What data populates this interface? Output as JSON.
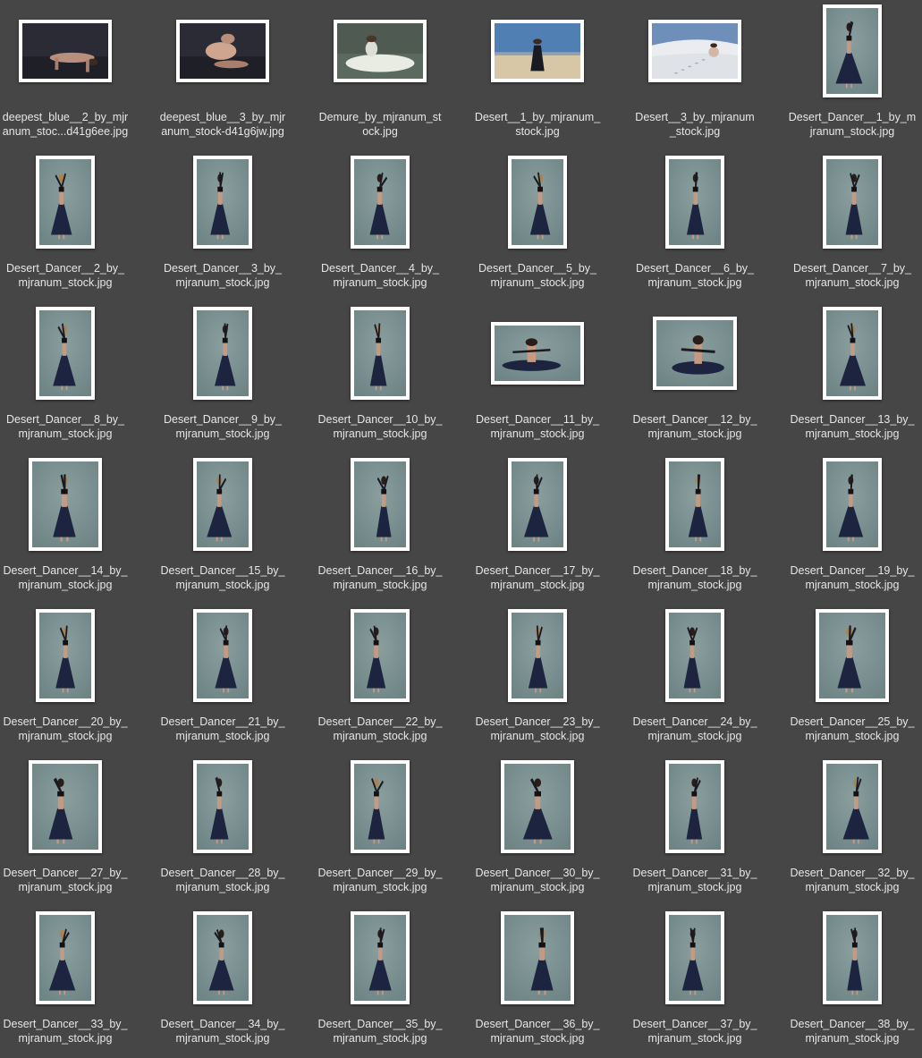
{
  "files": [
    {
      "name": "deepest_blue__2_by_mjranum_stock-d41g6ee.jpg",
      "label_lines": [
        "deepest_blue__2_by_mjr",
        "anum_stoc...d41g6ee.jpg"
      ],
      "kind": "dark-floor",
      "orientation": "landscape"
    },
    {
      "name": "deepest_blue__3_by_mjranum_stock-d41g6jw.jpg",
      "label_lines": [
        "deepest_blue__3_by_mjr",
        "anum_stock-d41g6jw.jpg"
      ],
      "kind": "dark-kneel",
      "orientation": "landscape"
    },
    {
      "name": "Demure_by_mjranum_stock.jpg",
      "label_lines": [
        "Demure_by_mjranum_st",
        "ock.jpg"
      ],
      "kind": "white-dress",
      "orientation": "landscape"
    },
    {
      "name": "Desert__1_by_mjranum_stock.jpg",
      "label_lines": [
        "Desert__1_by_mjranum_",
        "stock.jpg"
      ],
      "kind": "desert-standing",
      "orientation": "landscape"
    },
    {
      "name": "Desert__3_by_mjranum_stock.jpg",
      "label_lines": [
        "Desert__3_by_mjranum",
        "_stock.jpg"
      ],
      "kind": "desert-dune",
      "orientation": "landscape"
    },
    {
      "name": "Desert_Dancer__1_by_mjranum_stock.jpg",
      "label_lines": [
        "Desert_Dancer__1_by_m",
        "jranum_stock.jpg"
      ],
      "kind": "dancer",
      "orientation": "portrait"
    },
    {
      "name": "Desert_Dancer__2_by_mjranum_stock.jpg",
      "label_lines": [
        "Desert_Dancer__2_by_",
        "mjranum_stock.jpg"
      ],
      "kind": "dancer",
      "orientation": "portrait"
    },
    {
      "name": "Desert_Dancer__3_by_mjranum_stock.jpg",
      "label_lines": [
        "Desert_Dancer__3_by_",
        "mjranum_stock.jpg"
      ],
      "kind": "dancer",
      "orientation": "portrait"
    },
    {
      "name": "Desert_Dancer__4_by_mjranum_stock.jpg",
      "label_lines": [
        "Desert_Dancer__4_by_",
        "mjranum_stock.jpg"
      ],
      "kind": "dancer",
      "orientation": "portrait"
    },
    {
      "name": "Desert_Dancer__5_by_mjranum_stock.jpg",
      "label_lines": [
        "Desert_Dancer__5_by_",
        "mjranum_stock.jpg"
      ],
      "kind": "dancer",
      "orientation": "portrait"
    },
    {
      "name": "Desert_Dancer__6_by_mjranum_stock.jpg",
      "label_lines": [
        "Desert_Dancer__6_by_",
        "mjranum_stock.jpg"
      ],
      "kind": "dancer",
      "orientation": "portrait"
    },
    {
      "name": "Desert_Dancer__7_by_mjranum_stock.jpg",
      "label_lines": [
        "Desert_Dancer__7_by_",
        "mjranum_stock.jpg"
      ],
      "kind": "dancer",
      "orientation": "portrait"
    },
    {
      "name": "Desert_Dancer__8_by_mjranum_stock.jpg",
      "label_lines": [
        "Desert_Dancer__8_by_",
        "mjranum_stock.jpg"
      ],
      "kind": "dancer",
      "orientation": "portrait"
    },
    {
      "name": "Desert_Dancer__9_by_mjranum_stock.jpg",
      "label_lines": [
        "Desert_Dancer__9_by_",
        "mjranum_stock.jpg"
      ],
      "kind": "dancer",
      "orientation": "portrait"
    },
    {
      "name": "Desert_Dancer__10_by_mjranum_stock.jpg",
      "label_lines": [
        "Desert_Dancer__10_by_",
        "mjranum_stock.jpg"
      ],
      "kind": "dancer",
      "orientation": "portrait"
    },
    {
      "name": "Desert_Dancer__11_by_mjranum_stock.jpg",
      "label_lines": [
        "Desert_Dancer__11_by_",
        "mjranum_stock.jpg"
      ],
      "kind": "dancer-seated",
      "orientation": "landscape"
    },
    {
      "name": "Desert_Dancer__12_by_mjranum_stock.jpg",
      "label_lines": [
        "Desert_Dancer__12_by_",
        "mjranum_stock.jpg"
      ],
      "kind": "dancer-seated",
      "orientation": "landscape-tall"
    },
    {
      "name": "Desert_Dancer__13_by_mjranum_stock.jpg",
      "label_lines": [
        "Desert_Dancer__13_by_",
        "mjranum_stock.jpg"
      ],
      "kind": "dancer",
      "orientation": "portrait"
    },
    {
      "name": "Desert_Dancer__14_by_mjranum_stock.jpg",
      "label_lines": [
        "Desert_Dancer__14_by_",
        "mjranum_stock.jpg"
      ],
      "kind": "dancer",
      "orientation": "portrait-wide"
    },
    {
      "name": "Desert_Dancer__15_by_mjranum_stock.jpg",
      "label_lines": [
        "Desert_Dancer__15_by_",
        "mjranum_stock.jpg"
      ],
      "kind": "dancer",
      "orientation": "portrait"
    },
    {
      "name": "Desert_Dancer__16_by_mjranum_stock.jpg",
      "label_lines": [
        "Desert_Dancer__16_by_",
        "mjranum_stock.jpg"
      ],
      "kind": "dancer",
      "orientation": "portrait"
    },
    {
      "name": "Desert_Dancer__17_by_mjranum_stock.jpg",
      "label_lines": [
        "Desert_Dancer__17_by_",
        "mjranum_stock.jpg"
      ],
      "kind": "dancer",
      "orientation": "portrait"
    },
    {
      "name": "Desert_Dancer__18_by_mjranum_stock.jpg",
      "label_lines": [
        "Desert_Dancer__18_by_",
        "mjranum_stock.jpg"
      ],
      "kind": "dancer",
      "orientation": "portrait"
    },
    {
      "name": "Desert_Dancer__19_by_mjranum_stock.jpg",
      "label_lines": [
        "Desert_Dancer__19_by_",
        "mjranum_stock.jpg"
      ],
      "kind": "dancer",
      "orientation": "portrait"
    },
    {
      "name": "Desert_Dancer__20_by_mjranum_stock.jpg",
      "label_lines": [
        "Desert_Dancer__20_by_",
        "mjranum_stock.jpg"
      ],
      "kind": "dancer",
      "orientation": "portrait"
    },
    {
      "name": "Desert_Dancer__21_by_mjranum_stock.jpg",
      "label_lines": [
        "Desert_Dancer__21_by_",
        "mjranum_stock.jpg"
      ],
      "kind": "dancer",
      "orientation": "portrait"
    },
    {
      "name": "Desert_Dancer__22_by_mjranum_stock.jpg",
      "label_lines": [
        "Desert_Dancer__22_by_",
        "mjranum_stock.jpg"
      ],
      "kind": "dancer",
      "orientation": "portrait"
    },
    {
      "name": "Desert_Dancer__23_by_mjranum_stock.jpg",
      "label_lines": [
        "Desert_Dancer__23_by_",
        "mjranum_stock.jpg"
      ],
      "kind": "dancer",
      "orientation": "portrait"
    },
    {
      "name": "Desert_Dancer__24_by_mjranum_stock.jpg",
      "label_lines": [
        "Desert_Dancer__24_by_",
        "mjranum_stock.jpg"
      ],
      "kind": "dancer",
      "orientation": "portrait"
    },
    {
      "name": "Desert_Dancer__25_by_mjranum_stock.jpg",
      "label_lines": [
        "Desert_Dancer__25_by_",
        "mjranum_stock.jpg"
      ],
      "kind": "dancer",
      "orientation": "portrait-wide"
    },
    {
      "name": "Desert_Dancer__27_by_mjranum_stock.jpg",
      "label_lines": [
        "Desert_Dancer__27_by_",
        "mjranum_stock.jpg"
      ],
      "kind": "dancer",
      "orientation": "portrait-wide"
    },
    {
      "name": "Desert_Dancer__28_by_mjranum_stock.jpg",
      "label_lines": [
        "Desert_Dancer__28_by_",
        "mjranum_stock.jpg"
      ],
      "kind": "dancer",
      "orientation": "portrait"
    },
    {
      "name": "Desert_Dancer__29_by_mjranum_stock.jpg",
      "label_lines": [
        "Desert_Dancer__29_by_",
        "mjranum_stock.jpg"
      ],
      "kind": "dancer",
      "orientation": "portrait"
    },
    {
      "name": "Desert_Dancer__30_by_mjranum_stock.jpg",
      "label_lines": [
        "Desert_Dancer__30_by_",
        "mjranum_stock.jpg"
      ],
      "kind": "dancer",
      "orientation": "portrait-wide"
    },
    {
      "name": "Desert_Dancer__31_by_mjranum_stock.jpg",
      "label_lines": [
        "Desert_Dancer__31_by_",
        "mjranum_stock.jpg"
      ],
      "kind": "dancer",
      "orientation": "portrait"
    },
    {
      "name": "Desert_Dancer__32_by_mjranum_stock.jpg",
      "label_lines": [
        "Desert_Dancer__32_by_",
        "mjranum_stock.jpg"
      ],
      "kind": "dancer",
      "orientation": "portrait"
    },
    {
      "name": "Desert_Dancer__33_by_mjranum_stock.jpg",
      "label_lines": [
        "Desert_Dancer__33_by_",
        "mjranum_stock.jpg"
      ],
      "kind": "dancer",
      "orientation": "portrait"
    },
    {
      "name": "Desert_Dancer__34_by_mjranum_stock.jpg",
      "label_lines": [
        "Desert_Dancer__34_by_",
        "mjranum_stock.jpg"
      ],
      "kind": "dancer",
      "orientation": "portrait"
    },
    {
      "name": "Desert_Dancer__35_by_mjranum_stock.jpg",
      "label_lines": [
        "Desert_Dancer__35_by_",
        "mjranum_stock.jpg"
      ],
      "kind": "dancer",
      "orientation": "portrait"
    },
    {
      "name": "Desert_Dancer__36_by_mjranum_stock.jpg",
      "label_lines": [
        "Desert_Dancer__36_by_",
        "mjranum_stock.jpg"
      ],
      "kind": "dancer",
      "orientation": "portrait-wide"
    },
    {
      "name": "Desert_Dancer__37_by_mjranum_stock.jpg",
      "label_lines": [
        "Desert_Dancer__37_by_",
        "mjranum_stock.jpg"
      ],
      "kind": "dancer",
      "orientation": "portrait"
    },
    {
      "name": "Desert_Dancer__38_by_mjranum_stock.jpg",
      "label_lines": [
        "Desert_Dancer__38_by_",
        "mjranum_stock.jpg"
      ],
      "kind": "dancer",
      "orientation": "portrait"
    }
  ],
  "colors": {
    "background": "#464646",
    "label_text": "#e6e6e6",
    "thumb_border": "#ffffff",
    "studio_backdrop": "#6f8585",
    "costume": "#1d2440"
  }
}
